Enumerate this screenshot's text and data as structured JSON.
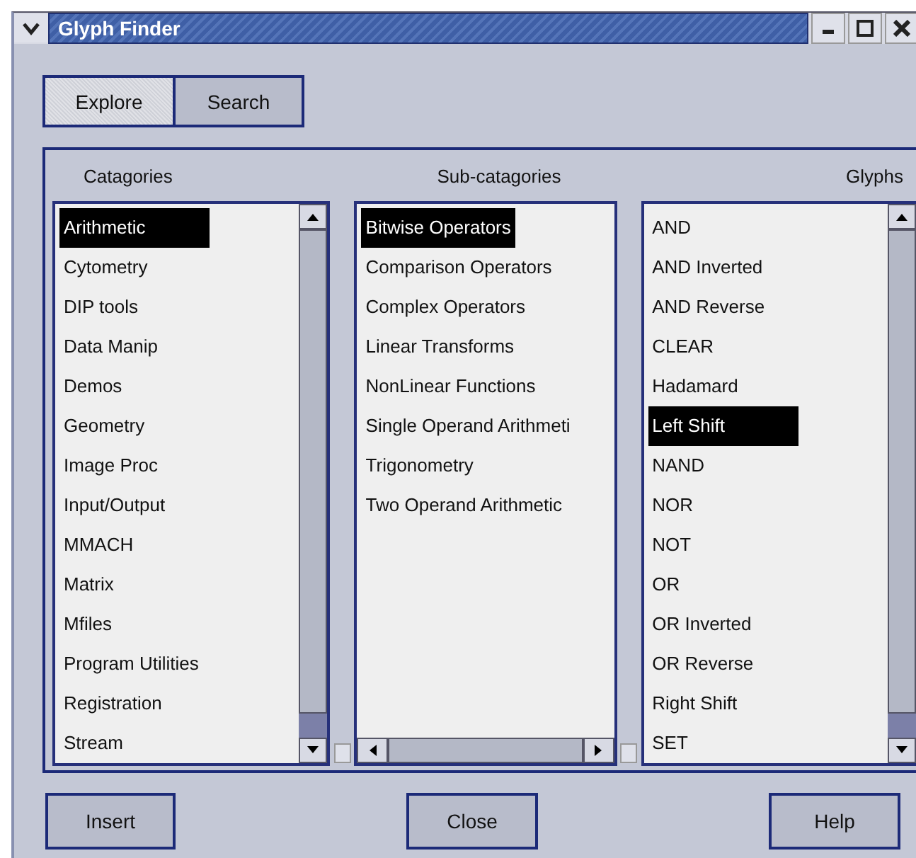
{
  "window": {
    "title": "Glyph Finder"
  },
  "tabs": [
    {
      "label": "Explore",
      "selected": true
    },
    {
      "label": "Search",
      "selected": false
    }
  ],
  "columns": [
    {
      "heading": "Catagories",
      "items": [
        {
          "label": "Arithmetic",
          "selected": true
        },
        {
          "label": "Cytometry",
          "selected": false
        },
        {
          "label": "DIP tools",
          "selected": false
        },
        {
          "label": "Data Manip",
          "selected": false
        },
        {
          "label": "Demos",
          "selected": false
        },
        {
          "label": "Geometry",
          "selected": false
        },
        {
          "label": "Image Proc",
          "selected": false
        },
        {
          "label": "Input/Output",
          "selected": false
        },
        {
          "label": "MMACH",
          "selected": false
        },
        {
          "label": "Matrix",
          "selected": false
        },
        {
          "label": "Mfiles",
          "selected": false
        },
        {
          "label": "Program Utilities",
          "selected": false
        },
        {
          "label": "Registration",
          "selected": false
        },
        {
          "label": "Stream",
          "selected": false
        }
      ]
    },
    {
      "heading": "Sub-catagories",
      "items": [
        {
          "label": "Bitwise Operators",
          "selected": true
        },
        {
          "label": "Comparison Operators",
          "selected": false
        },
        {
          "label": "Complex Operators",
          "selected": false
        },
        {
          "label": "Linear Transforms",
          "selected": false
        },
        {
          "label": "NonLinear Functions",
          "selected": false
        },
        {
          "label": "Single Operand Arithmeti",
          "selected": false
        },
        {
          "label": "Trigonometry",
          "selected": false
        },
        {
          "label": "Two Operand Arithmetic",
          "selected": false
        }
      ]
    },
    {
      "heading": "Glyphs",
      "items": [
        {
          "label": "AND",
          "selected": false
        },
        {
          "label": "AND Inverted",
          "selected": false
        },
        {
          "label": "AND Reverse",
          "selected": false
        },
        {
          "label": "CLEAR",
          "selected": false
        },
        {
          "label": "Hadamard",
          "selected": false
        },
        {
          "label": "Left Shift",
          "selected": true
        },
        {
          "label": "NAND",
          "selected": false
        },
        {
          "label": "NOR",
          "selected": false
        },
        {
          "label": "NOT",
          "selected": false
        },
        {
          "label": "OR",
          "selected": false
        },
        {
          "label": "OR Inverted",
          "selected": false
        },
        {
          "label": "OR Reverse",
          "selected": false
        },
        {
          "label": "Right Shift",
          "selected": false
        },
        {
          "label": "SET",
          "selected": false
        }
      ]
    }
  ],
  "buttons": [
    "Insert",
    "Close",
    "Help"
  ]
}
